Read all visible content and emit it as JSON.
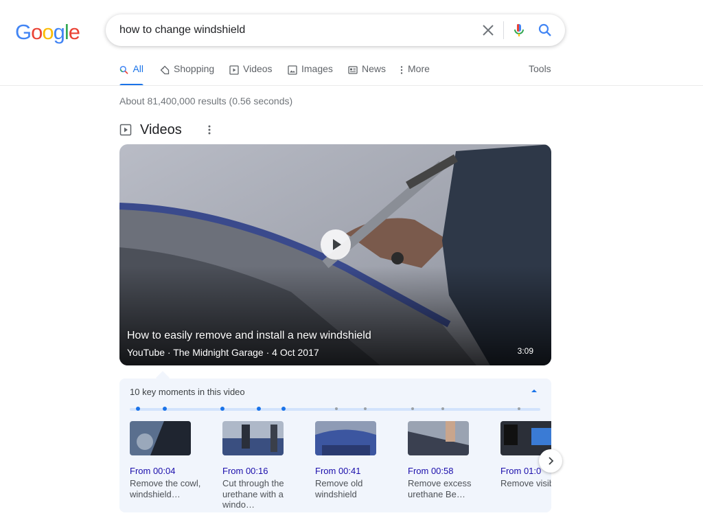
{
  "logo": {
    "letters": [
      "G",
      "o",
      "o",
      "g",
      "l",
      "e"
    ],
    "colors": [
      "#4285F4",
      "#EA4335",
      "#FBBC05",
      "#4285F4",
      "#34A853",
      "#EA4335"
    ]
  },
  "search": {
    "query": "how to change windshield"
  },
  "tabs": [
    {
      "label": "All",
      "icon": "search-icon",
      "active": true
    },
    {
      "label": "Shopping",
      "icon": "tag-icon"
    },
    {
      "label": "Videos",
      "icon": "play-box-icon"
    },
    {
      "label": "Images",
      "icon": "image-icon"
    },
    {
      "label": "News",
      "icon": "newspaper-icon"
    },
    {
      "label": "More",
      "icon": "more-vert-icon"
    }
  ],
  "tools_label": "Tools",
  "result_stats": "About 81,400,000 results (0.56 seconds)",
  "videos_section": {
    "heading": "Videos",
    "featured": {
      "title": "How to easily remove and install a new windshield",
      "meta": "YouTube · The Midnight Garage · 4 Oct 2017",
      "duration": "3:09"
    },
    "key_moments": {
      "title": "10 key moments in this video",
      "markers": [
        0.02,
        0.085,
        0.225,
        0.315,
        0.375,
        0.505,
        0.575,
        0.69,
        0.765,
        0.95
      ],
      "items": [
        {
          "from": "From 00:04",
          "desc": "Remove the cowl, windshield…"
        },
        {
          "from": "From 00:16",
          "desc": "Cut through the urethane with a windo…"
        },
        {
          "from": "From 00:41",
          "desc": "Remove old windshield"
        },
        {
          "from": "From 00:58",
          "desc": "Remove excess urethane Be…"
        },
        {
          "from": "From 01:0",
          "desc": "Remove visible dirt"
        }
      ]
    }
  },
  "colors": {
    "accent": "#1a73e8",
    "link": "#1a0dab"
  }
}
